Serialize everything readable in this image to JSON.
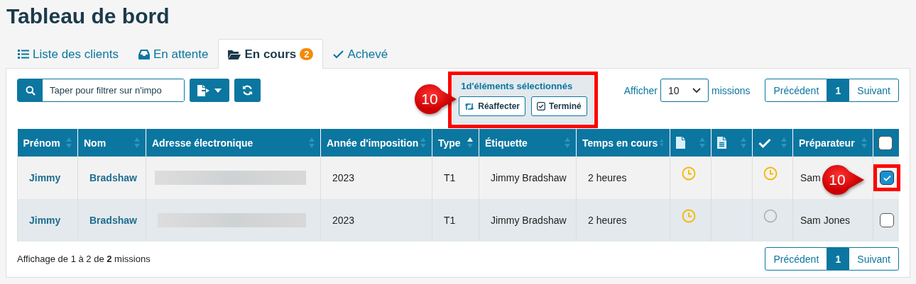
{
  "title": "Tableau de bord",
  "tabs": [
    {
      "label": "Liste des clients",
      "selected": false
    },
    {
      "label": "En attente",
      "selected": false
    },
    {
      "label": "En cours",
      "badge": "2",
      "selected": true
    },
    {
      "label": "Achevé",
      "selected": false
    }
  ],
  "search": {
    "placeholder": "Taper pour filtrer sur n'impo"
  },
  "selection_bar": {
    "text": "1d'éléments sélectionnés",
    "highlighted": true,
    "buttons": [
      {
        "label": "Réaffecter"
      },
      {
        "label": "Terminé"
      }
    ]
  },
  "page_size": {
    "prefix": "Afficher",
    "value": "10",
    "suffix": "missions"
  },
  "pager_top": {
    "previous": "Précédent",
    "page": "1",
    "next": "Suivant"
  },
  "table": {
    "columns": [
      {
        "label": "Prénom",
        "sorted": false
      },
      {
        "label": "Nom",
        "sorted": false
      },
      {
        "label": "Adresse électronique",
        "sorted": false
      },
      {
        "label": "Année d'imposition",
        "sorted": false
      },
      {
        "label": "Type",
        "sorted": true
      },
      {
        "label": "Étiquette",
        "sorted": false
      },
      {
        "label": "Temps en cours",
        "sorted": false
      },
      {
        "sorted": false
      },
      {
        "sorted": false
      },
      {
        "sorted": false
      },
      {
        "label": "Préparateur",
        "sorted": false
      },
      {
        "checked": false
      }
    ],
    "rows": [
      {
        "first_name": "Jimmy",
        "last_name": "Bradshaw",
        "year": "2023",
        "type": "T1",
        "tag": "Jimmy Bradshaw",
        "time": "2 heures",
        "statuses": [
          {
            "kind": "clock"
          },
          {
            "kind": "blank"
          },
          {
            "kind": "clock"
          }
        ],
        "preparer": "Sam",
        "selected": true,
        "highlighted": true
      },
      {
        "first_name": "Jimmy",
        "last_name": "Bradshaw",
        "year": "2023",
        "type": "T1",
        "tag": "Jimmy Bradshaw",
        "time": "2 heures",
        "statuses": [
          {
            "kind": "clock"
          },
          {
            "kind": "blank"
          },
          {
            "kind": "circle"
          }
        ],
        "preparer": "Sam Jones",
        "selected": false,
        "highlighted": false
      }
    ]
  },
  "footer": "Affichage de 1 à 2 de **2** missions",
  "pager_bottom": {
    "previous": "Précédent",
    "page": "1",
    "next": "Suivant"
  },
  "callouts": [
    {
      "label": "10"
    },
    {
      "label": "10"
    }
  ]
}
